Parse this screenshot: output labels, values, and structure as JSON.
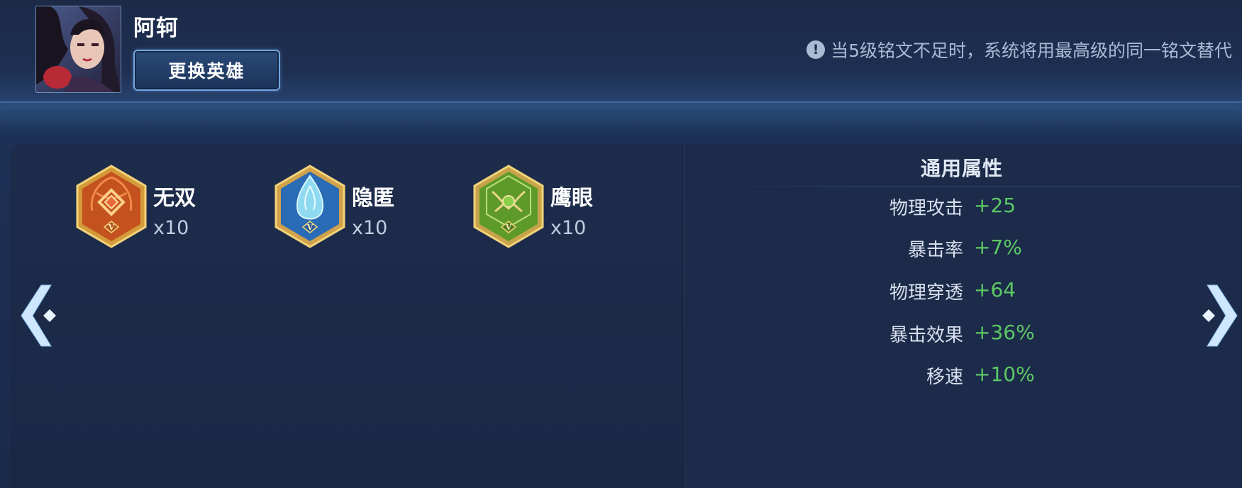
{
  "header": {
    "hero_name": "阿轲",
    "switch_hero_label": "更换英雄",
    "notice_text": "当5级铭文不足时，系统将用最高级的同一铭文替代"
  },
  "runes": [
    {
      "name": "无双",
      "count": "x10",
      "level": "V",
      "color": "#c4521e",
      "icon": "wushuang-rune-icon"
    },
    {
      "name": "隐匿",
      "count": "x10",
      "level": "V",
      "color": "#2a6bb5",
      "icon": "yinni-rune-icon"
    },
    {
      "name": "鹰眼",
      "count": "x10",
      "level": "V",
      "color": "#5e9a2a",
      "icon": "yingyan-rune-icon"
    }
  ],
  "stats": {
    "title": "通用属性",
    "rows": [
      {
        "label": "物理攻击",
        "value": "+25"
      },
      {
        "label": "暴击率",
        "value": "+7%"
      },
      {
        "label": "物理穿透",
        "value": "+64"
      },
      {
        "label": "暴击效果",
        "value": "+36%"
      },
      {
        "label": "移速",
        "value": "+10%"
      }
    ]
  },
  "colors": {
    "accent_green": "#5cc866",
    "header_border": "#3d6aa3",
    "text_muted": "#a9bad3"
  }
}
